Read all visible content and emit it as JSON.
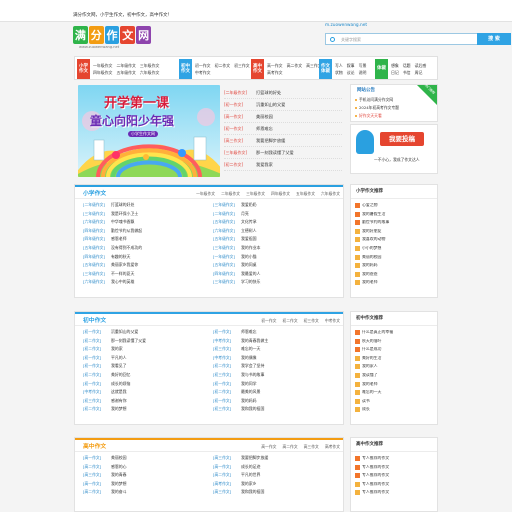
{
  "topbar": {
    "text": "满分作文网，小学生作文，初中作文，高中作文！"
  },
  "logo": {
    "chars": [
      "满",
      "分",
      "作",
      "文",
      "网"
    ],
    "colors": [
      "#2fb44a",
      "#f39c12",
      "#2aa0e0",
      "#e5452f",
      "#8e44ad"
    ],
    "sub": "www.zuowenwang.net"
  },
  "search": {
    "domain": "m.zuowenwang.net",
    "placeholder": "关键字搜索",
    "button": "搜 索"
  },
  "nav": {
    "groups": [
      {
        "tag": "小学作文",
        "color": "#e5452f",
        "items": [
          "一年级作文",
          "二年级作文",
          "三年级作文",
          "四年级作文",
          "五年级作文",
          "六年级作文"
        ]
      },
      {
        "tag": "初中作文",
        "color": "#2fa3e4",
        "items": [
          "初一作文",
          "初二作文",
          "初三作文",
          "中考作文"
        ]
      },
      {
        "tag": "高中作文",
        "color": "#e5452f",
        "items": [
          "高一作文",
          "高二作文",
          "高三作文",
          "高考作文"
        ]
      },
      {
        "tag": "作文体裁",
        "color": "#2fa3e4",
        "items": [
          "写人",
          "叙事",
          "写景",
          "状物",
          "议论",
          "说明"
        ]
      },
      {
        "tag": "体裁",
        "color": "#2fb44a",
        "items": [
          "想象",
          "话题",
          "读后感",
          "日记",
          "书信",
          "周记"
        ]
      }
    ]
  },
  "banner": {
    "line1": "开学第一课",
    "line2": "童心向阳少年强",
    "badge": "小学生作文网"
  },
  "news": [
    {
      "cat": "[二年级作文]",
      "title": "打篮球的好处"
    },
    {
      "cat": "[初一作文]",
      "title": "沉重如山的父爱"
    },
    {
      "cat": "[高一作文]",
      "title": "美丽校园"
    },
    {
      "cat": "[初一作文]",
      "title": "师恩难忘"
    },
    {
      "cat": "[高三作文]",
      "title": "我要把脚步放缓"
    },
    {
      "cat": "[三年级作文]",
      "title": "那一刻我读懂了父爱"
    },
    {
      "cat": "[初二作文]",
      "title": "我爱我家"
    }
  ],
  "notice": {
    "title": "网站公告",
    "corner": "热门推荐",
    "lines": [
      "手机访问满分作文网",
      "2024年初高考作文专题",
      "好作文天天看"
    ]
  },
  "ad": {
    "btn": "我要投稿",
    "slogan": "一不小心，我成了作文达人"
  },
  "primary": {
    "title": "小学作文",
    "tabs": [
      "一年级作文",
      "二年级作文",
      "三年级作文",
      "四年级作文",
      "五年级作文",
      "六年级作文"
    ],
    "left": [
      {
        "c": "[二年级作文]",
        "t": "打篮球的好处"
      },
      {
        "c": "[三年级作文]",
        "t": "我是环保小卫士"
      },
      {
        "c": "[六年级作文]",
        "t": "中华魂书香飘"
      },
      {
        "c": "[四年级作文]",
        "t": "勤俭节约从我做起"
      },
      {
        "c": "[四年级作文]",
        "t": "感恩老师"
      },
      {
        "c": "[五年级作文]",
        "t": "没有得到不成功的"
      },
      {
        "c": "[四年级作文]",
        "t": "有趣的秋天"
      },
      {
        "c": "[五年级作文]",
        "t": "美丽家乡我爱你"
      },
      {
        "c": "[三年级作文]",
        "t": "不一样的夏天"
      },
      {
        "c": "[六年级作文]",
        "t": "我心中的英雄"
      }
    ],
    "right": [
      {
        "c": "[三年级作文]",
        "t": "我爱奶奶"
      },
      {
        "c": "[二年级作文]",
        "t": "月亮"
      },
      {
        "c": "[五年级作文]",
        "t": "文化传承"
      },
      {
        "c": "[六年级作文]",
        "t": "立德树人"
      },
      {
        "c": "[五年级作文]",
        "t": "我爱祖国"
      },
      {
        "c": "[三年级作文]",
        "t": "我的作业本"
      },
      {
        "c": "[一年级作文]",
        "t": "我的小猫"
      },
      {
        "c": "[五年级作文]",
        "t": "我的同桌"
      },
      {
        "c": "[四年级作文]",
        "t": "我最爱的人"
      },
      {
        "c": "[三年级作文]",
        "t": "学习的快乐"
      }
    ],
    "side_title": "小学作文推荐",
    "side": [
      "心爱之物",
      "我的暑假生活",
      "勤俭节约的故事",
      "我的好朋友",
      "我喜欢的动物",
      "小小的梦想",
      "美丽的校园",
      "我的妈妈",
      "我的爸爸",
      "我的老师"
    ]
  },
  "middle": {
    "title": "初中作文",
    "tabs": [
      "初一作文",
      "初二作文",
      "初三作文",
      "中考作文"
    ],
    "left": [
      {
        "c": "[初一作文]",
        "t": "沉重如山的父爱"
      },
      {
        "c": "[初二作文]",
        "t": "那一刻我读懂了父爱"
      },
      {
        "c": "[初二作文]",
        "t": "我的家"
      },
      {
        "c": "[初一作文]",
        "t": "平凡的人"
      },
      {
        "c": "[初一作文]",
        "t": "我看见了"
      },
      {
        "c": "[初二作文]",
        "t": "美好的回忆"
      },
      {
        "c": "[初一作文]",
        "t": "成长的烦恼"
      },
      {
        "c": "[中考作文]",
        "t": "这就是我"
      },
      {
        "c": "[初三作文]",
        "t": "感谢有你"
      },
      {
        "c": "[初二作文]",
        "t": "我的梦想"
      }
    ],
    "right": [
      {
        "c": "[初一作文]",
        "t": "师恩难忘"
      },
      {
        "c": "[中考作文]",
        "t": "我的青春我做主"
      },
      {
        "c": "[初三作文]",
        "t": "难忘的一天"
      },
      {
        "c": "[中考作文]",
        "t": "我的偶像"
      },
      {
        "c": "[初二作文]",
        "t": "我学会了坚持"
      },
      {
        "c": "[初三作文]",
        "t": "我与书的故事"
      },
      {
        "c": "[初一作文]",
        "t": "我的同学"
      },
      {
        "c": "[初二作文]",
        "t": "最美的风景"
      },
      {
        "c": "[初一作文]",
        "t": "我的妈妈"
      },
      {
        "c": "[初三作文]",
        "t": "我和我的祖国"
      }
    ],
    "side_title": "初中作文推荐",
    "side": [
      "什么是真正的幸福",
      "秋天的落叶",
      "什么是成功",
      "美好的生活",
      "我的家人",
      "我读懂了",
      "我的老师",
      "难忘的一天",
      "读书",
      "成长"
    ]
  },
  "high": {
    "title": "高中作文",
    "tabs": [
      "高一作文",
      "高二作文",
      "高三作文",
      "高考作文"
    ],
    "left": [
      {
        "c": "[高一作文]",
        "t": "美丽校园"
      },
      {
        "c": "[高二作文]",
        "t": "感恩的心"
      },
      {
        "c": "[高三作文]",
        "t": "我的青春"
      },
      {
        "c": "[高一作文]",
        "t": "我的梦想"
      },
      {
        "c": "[高二作文]",
        "t": "我的奋斗"
      }
    ],
    "right": [
      {
        "c": "[高三作文]",
        "t": "我要把脚步放缓"
      },
      {
        "c": "[高一作文]",
        "t": "成长的足迹"
      },
      {
        "c": "[高二作文]",
        "t": "平凡的世界"
      },
      {
        "c": "[高考作文]",
        "t": "我的家乡"
      },
      {
        "c": "[高三作文]",
        "t": "我和我的祖国"
      }
    ],
    "side_title": "高中作文推荐",
    "side": [
      "专人推荐的作文",
      "专人推荐的作文",
      "专人推荐的作文",
      "专人推荐的作文",
      "专人推荐的作文"
    ]
  }
}
